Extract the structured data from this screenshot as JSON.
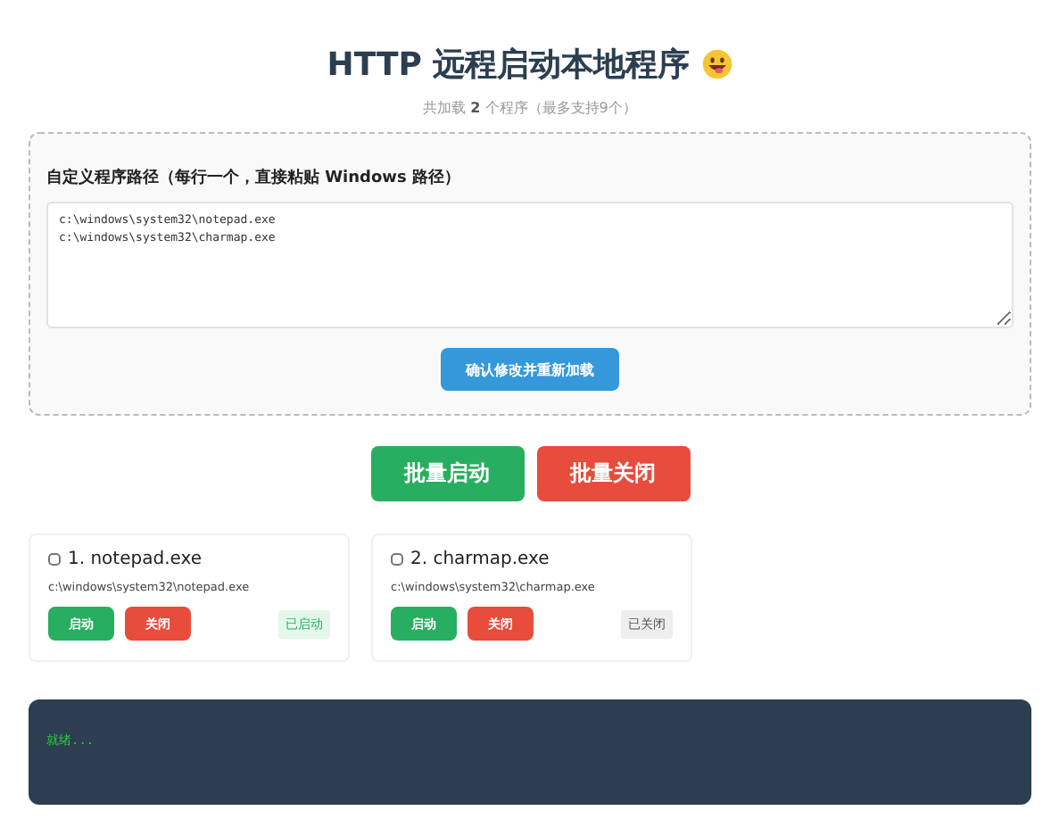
{
  "title": "HTTP 远程启动本地程序",
  "subtitle": {
    "before": "共加载 ",
    "count": "2",
    "after": " 个程序（最多支持9个）"
  },
  "config": {
    "label": "自定义程序路径（每行一个，直接粘贴 Windows 路径）",
    "value": "c:\\windows\\system32\\notepad.exe\nc:\\windows\\system32\\charmap.exe",
    "button": "确认修改并重新加载"
  },
  "batch_buttons": [
    {
      "label": "批量启动",
      "kind": "start"
    },
    {
      "label": "批量关闭",
      "kind": "stop"
    }
  ],
  "programs": [
    {
      "name": "1. notepad.exe",
      "checked": false,
      "path": "c:\\windows\\system32\\notepad.exe",
      "start": "启动",
      "stop": "关闭",
      "status": "已启动",
      "running": true
    },
    {
      "name": "2. charmap.exe",
      "checked": false,
      "path": "c:\\windows\\system32\\charmap.exe",
      "start": "启动",
      "stop": "关闭",
      "status": "已关闭",
      "running": false
    }
  ],
  "log": "就绪..."
}
